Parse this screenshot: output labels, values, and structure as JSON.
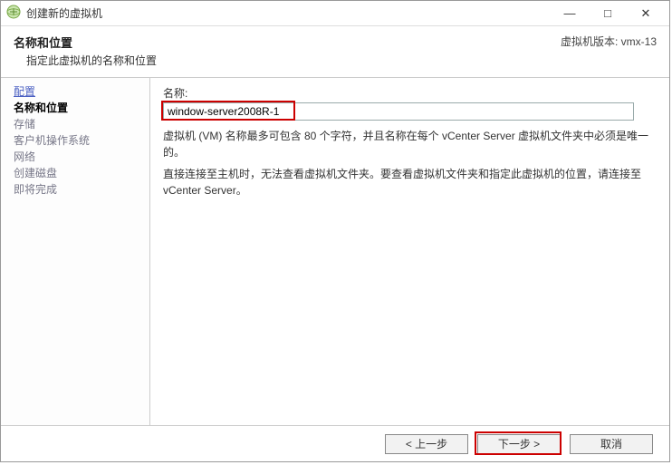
{
  "window": {
    "title": "创建新的虚拟机"
  },
  "header": {
    "title": "名称和位置",
    "subtitle": "指定此虚拟机的名称和位置",
    "version": "虚拟机版本: vmx-13"
  },
  "sidebar": {
    "items": [
      {
        "label": "配置",
        "kind": "link"
      },
      {
        "label": "名称和位置",
        "kind": "current"
      },
      {
        "label": "存储",
        "kind": "disabled"
      },
      {
        "label": "客户机操作系统",
        "kind": "disabled"
      },
      {
        "label": "网络",
        "kind": "disabled"
      },
      {
        "label": "创建磁盘",
        "kind": "disabled"
      },
      {
        "label": "即将完成",
        "kind": "disabled"
      }
    ]
  },
  "form": {
    "name_label": "名称:",
    "name_value": "window-server2008R-1",
    "hint1": "虚拟机 (VM) 名称最多可包含 80 个字符，并且名称在每个 vCenter Server 虚拟机文件夹中必须是唯一的。",
    "hint2": "直接连接至主机时，无法查看虚拟机文件夹。要查看虚拟机文件夹和指定此虚拟机的位置，请连接至 vCenter Server。"
  },
  "buttons": {
    "back": "< 上一步",
    "next": "下一步 >",
    "cancel": "取消"
  }
}
